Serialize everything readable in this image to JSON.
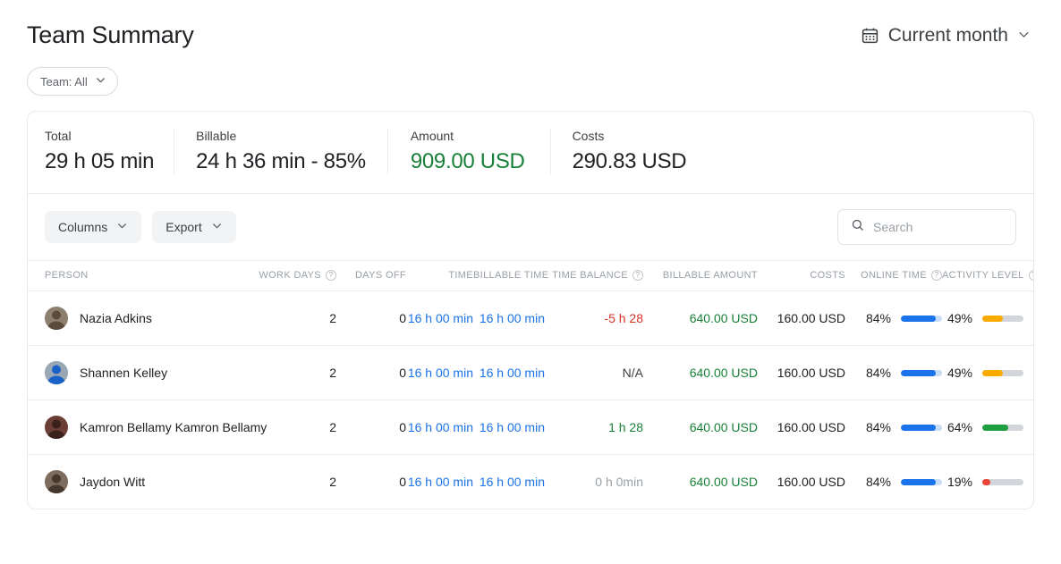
{
  "header": {
    "title": "Team Summary",
    "date_filter": {
      "label": "Current month",
      "icon": "calendar-icon",
      "chevron": "⌄"
    }
  },
  "filters": {
    "team": {
      "label": "Team: All",
      "chevron": "⌄"
    }
  },
  "stats": [
    {
      "label": "Total",
      "value": "29 h 05 min",
      "color": "#202124"
    },
    {
      "label": "Billable",
      "value": "24 h 36 min - 85%",
      "color": "#202124"
    },
    {
      "label": "Amount",
      "value": "909.00 USD",
      "color": "#188038"
    },
    {
      "label": "Costs",
      "value": "290.83 USD",
      "color": "#202124"
    }
  ],
  "toolbar": {
    "columns_label": "Columns",
    "export_label": "Export",
    "chevron": "⌄",
    "search_placeholder": "Search",
    "search_value": "",
    "search_icon": "search-icon"
  },
  "table": {
    "columns": [
      {
        "key": "person",
        "label": "PERSON",
        "help": false
      },
      {
        "key": "workdays",
        "label": "WORK DAYS",
        "help": true
      },
      {
        "key": "daysoff",
        "label": "DAYS OFF",
        "help": false
      },
      {
        "key": "time",
        "label": "TIME",
        "help": false
      },
      {
        "key": "btime",
        "label": "BILLABLE TIME",
        "help": false
      },
      {
        "key": "balance",
        "label": "TIME BALANCE",
        "help": true
      },
      {
        "key": "bamount",
        "label": "BILLABLE AMOUNT",
        "help": false
      },
      {
        "key": "costs",
        "label": "COSTS",
        "help": false
      },
      {
        "key": "online",
        "label": "ONLINE TIME",
        "help": true
      },
      {
        "key": "activity",
        "label": "ACTIVITY LEVEL",
        "help": true
      }
    ],
    "help_glyph": "?",
    "rows": [
      {
        "name": "Nazia Adkins",
        "avatar_colors": [
          "#8d7f6e",
          "#5b4b3a"
        ],
        "work_days": "2",
        "days_off": "0",
        "time": "16 h 00 min",
        "billable_time": "16 h 00 min",
        "time_balance": "-5 h 28",
        "time_balance_state": "negative",
        "billable_amount": "640.00 USD",
        "costs": "160.00 USD",
        "online_pct_label": "84%",
        "online_pct": 84,
        "activity_pct_label": "49%",
        "activity_pct": 49,
        "activity_color": "#f9ab00"
      },
      {
        "name": "Shannen Kelley",
        "avatar_colors": [
          "#9aa7b4",
          "#1a62c7"
        ],
        "work_days": "2",
        "days_off": "0",
        "time": "16 h 00 min",
        "billable_time": "16 h 00 min",
        "time_balance": "N/A",
        "time_balance_state": "neutral",
        "billable_amount": "640.00 USD",
        "costs": "160.00 USD",
        "online_pct_label": "84%",
        "online_pct": 84,
        "activity_pct_label": "49%",
        "activity_pct": 49,
        "activity_color": "#f9ab00"
      },
      {
        "name": "Kamron Bellamy Kamron Bellamy",
        "avatar_colors": [
          "#6b3f36",
          "#3a211c"
        ],
        "work_days": "2",
        "days_off": "0",
        "time": "16 h 00 min",
        "billable_time": "16 h 00 min",
        "time_balance": "1 h 28",
        "time_balance_state": "positive",
        "billable_amount": "640.00 USD",
        "costs": "160.00 USD",
        "online_pct_label": "84%",
        "online_pct": 84,
        "activity_pct_label": "64%",
        "activity_pct": 64,
        "activity_color": "#1e9e3e"
      },
      {
        "name": "Jaydon Witt",
        "avatar_colors": [
          "#7d6b5d",
          "#46372c"
        ],
        "work_days": "2",
        "days_off": "0",
        "time": "16 h 00 min",
        "billable_time": "16 h 00 min",
        "time_balance": "0 h 0min",
        "time_balance_state": "zero",
        "billable_amount": "640.00 USD",
        "costs": "160.00 USD",
        "online_pct_label": "84%",
        "online_pct": 84,
        "activity_pct_label": "19%",
        "activity_pct": 19,
        "activity_color": "#ea4335"
      }
    ]
  },
  "colors": {
    "link": "#1a73e8",
    "green": "#188038",
    "red": "#d93025",
    "online_bar": "#1a73e8",
    "online_track": "#c9dcf8",
    "activity_track": "#d2d5d9"
  }
}
